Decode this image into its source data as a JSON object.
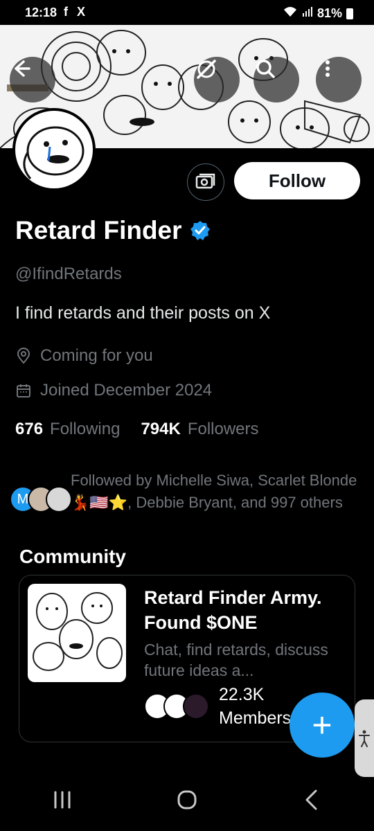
{
  "status_bar": {
    "time": "12:18",
    "left_icons": "f X",
    "battery": "81%"
  },
  "profile": {
    "display_name": "Retard Finder",
    "handle": "@IfindRetards",
    "bio": "I find retards and their posts on X",
    "location": "Coming for you",
    "joined": "Joined December 2024",
    "following_count": "676",
    "following_label": "Following",
    "followers_count": "794K",
    "followers_label": "Followers",
    "followed_by": "Followed by Michelle Siwa, Scarlet Blonde 💃🇺🇸⭐, Debbie Bryant, and 997 others",
    "follow_button": "Follow",
    "mini_avatar_letter": "M"
  },
  "community": {
    "heading": "Community",
    "name": "Retard Finder Army. Found $ONE",
    "description": "Chat, find retards, discuss future ideas a...",
    "member_count": "22.3K",
    "member_label": "Members"
  },
  "icons": {
    "fab": "+"
  },
  "colors": {
    "accent": "#1d9bf0",
    "background": "#000000",
    "secondary_text": "#71767b"
  }
}
